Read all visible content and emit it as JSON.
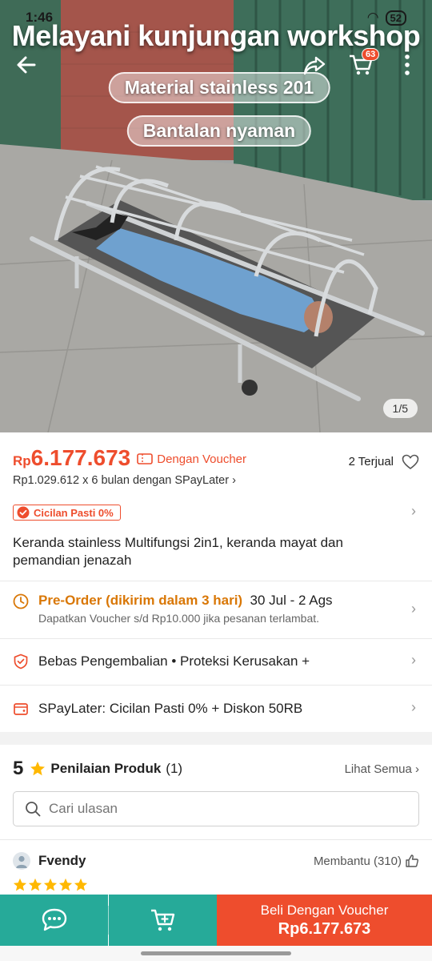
{
  "status_bar": {
    "time": "1:46",
    "battery": "52"
  },
  "hero": {
    "banner_title": "Melayani kunjungan workshop",
    "pills": [
      "Material stainless 201",
      "Bantalan nyaman"
    ],
    "cart_badge": "63",
    "image_counter": "1/5",
    "icons": {
      "back": "back-arrow-icon",
      "share": "share-icon",
      "cart": "cart-icon",
      "more": "more-vertical-icon"
    }
  },
  "price": {
    "currency": "Rp",
    "amount": "6.177.673",
    "voucher_label": "Dengan Voucher",
    "sold": "2 Terjual",
    "installment": "Rp1.029.612 x 6 bulan dengan SPayLater",
    "cicilan_badge": "Cicilan Pasti 0%"
  },
  "product_title": "Keranda stainless Multifungsi 2in1, keranda mayat dan pemandian jenazah",
  "preorder": {
    "label": "Pre-Order (dikirim dalam 3 hari)",
    "dates": "30 Jul - 2 Ags",
    "sub": "Dapatkan Voucher s/d Rp10.000 jika pesanan terlambat."
  },
  "guarantees": "Bebas Pengembalian  •  Proteksi Kerusakan +",
  "spaylater": "SPayLater: Cicilan Pasti 0% + Diskon 50RB",
  "reviews": {
    "score": "5",
    "label": "Penilaian Produk",
    "count": "(1)",
    "see_all": "Lihat Semua",
    "search_placeholder": "Cari ulasan",
    "reviewer": "Fvendy",
    "helpful": "Membantu (310)",
    "stars": 5
  },
  "bottom_bar": {
    "buy_label": "Beli Dengan Voucher",
    "buy_price": "Rp6.177.673"
  },
  "colors": {
    "accent": "#ee4d2d",
    "teal": "#26aa99",
    "preorder": "#d97706",
    "star": "#ffb800"
  }
}
